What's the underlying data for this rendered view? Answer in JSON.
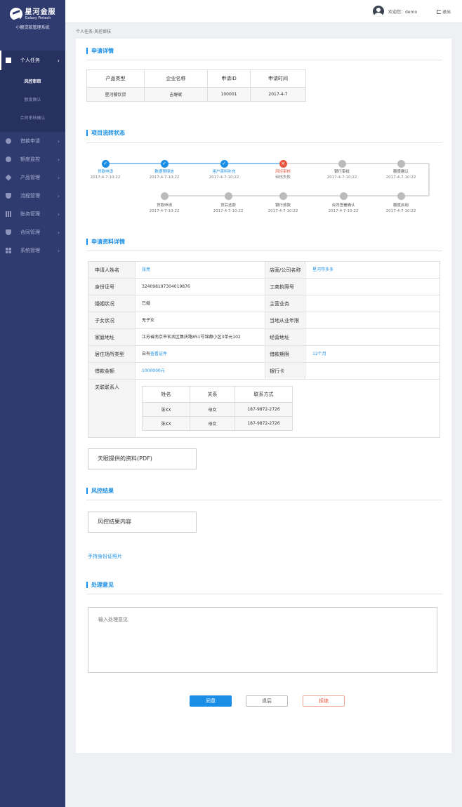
{
  "brand": {
    "name_cn": "星河金服",
    "name_en": "Galaxy Fintech",
    "system": "小额贷款管理系统"
  },
  "sidebar": {
    "items": [
      {
        "label": "个人任务",
        "icon": "task-icon",
        "active": true,
        "children": [
          {
            "label": "风控审审",
            "active": true
          },
          {
            "label": "额度确认",
            "active": false
          },
          {
            "label": "合同审核确认",
            "active": false
          }
        ]
      },
      {
        "label": "借款申请",
        "icon": "loan-icon"
      },
      {
        "label": "额度监控",
        "icon": "pie-icon"
      },
      {
        "label": "产品管理",
        "icon": "product-icon"
      },
      {
        "label": "流程管理",
        "icon": "shield-icon"
      },
      {
        "label": "账务管理",
        "icon": "bar-chart-icon"
      },
      {
        "label": "合同管理",
        "icon": "contract-icon"
      },
      {
        "label": "系统管理",
        "icon": "grid-icon"
      }
    ]
  },
  "topbar": {
    "welcome": "欢迎您：demo",
    "logout": "退出"
  },
  "breadcrumb": "个人任务-风控审核",
  "sections": {
    "application": "申请详情",
    "flow": "项目流转状态",
    "details": "申请资料详情",
    "risk_result": "风控结果",
    "opinion": "处理意见"
  },
  "application": {
    "headers": [
      "产品类型",
      "企业名称",
      "申请ID",
      "申请时间"
    ],
    "row": [
      "星河餐饮贷",
      "吉野家",
      "100001",
      "2017-4-7"
    ]
  },
  "flow": {
    "row1": [
      {
        "label": "贷款申请",
        "date": "2017-4-7-10:22",
        "status": "done"
      },
      {
        "label": "数据预授信",
        "date": "2017-4-7-10:22",
        "status": "done"
      },
      {
        "label": "用户资料补充",
        "date": "2017-4-7-10:22",
        "status": "done"
      },
      {
        "label": "风控审核",
        "date": "审核失败",
        "status": "failed"
      },
      {
        "label": "银行审批",
        "date": "2017-4-7-10:22",
        "status": "pending"
      },
      {
        "label": "额度确认",
        "date": "2017-4-7-10:22",
        "status": "pending"
      }
    ],
    "row2": [
      {
        "label": "额度启用",
        "date": "2017-4-7-10:22",
        "status": "pending"
      },
      {
        "label": "合同签署确认",
        "date": "2017-4-7-10:22",
        "status": "pending"
      },
      {
        "label": "银行放款",
        "date": "2017-4-7-10:22",
        "status": "pending"
      },
      {
        "label": "贷后还款",
        "date": "2017-4-7-10:22",
        "status": "pending"
      },
      {
        "label": "贷款申请",
        "date": "2017-4-7-10:22",
        "status": "pending"
      }
    ]
  },
  "details": {
    "rows": [
      {
        "k1": "申请人姓名",
        "v1": "张亮",
        "v1_link": true,
        "k2": "店面/公司名称",
        "v2": "星河夺多多",
        "v2_link": true
      },
      {
        "k1": "身份证号",
        "v1": "324098197304019876",
        "k2": "工商执照号",
        "v2": ""
      },
      {
        "k1": "婚姻状况",
        "v1": "已婚",
        "k2": "主营业务",
        "v2": ""
      },
      {
        "k1": "子女状况",
        "v1": "无子女",
        "k2": "当地从业年限",
        "v2": ""
      },
      {
        "k1": "家庭地址",
        "v1": "江苏省南京市玄武区集庆路851号锦都小区3单元102",
        "k2": "经营地址",
        "v2": ""
      },
      {
        "k1": "居住场所类型",
        "v1": "自有",
        "v1_extra": "查看证件",
        "k2": "借款期限",
        "v2": "12个月",
        "v2_link": true
      },
      {
        "k1": "借款金额",
        "v1": "1000000元",
        "v1_link": true,
        "k2": "银行卡",
        "v2": ""
      }
    ],
    "contacts_label": "关联联系人",
    "contacts": {
      "headers": [
        "姓名",
        "关系",
        "联系方式"
      ],
      "rows": [
        [
          "张XX",
          "母女",
          "187-9872-2726"
        ],
        [
          "张XX",
          "母女",
          "187-9872-2726"
        ]
      ]
    }
  },
  "tianyan_pdf": "天眼提供的资料(PDF)",
  "risk_result_content": "风控结果内容",
  "id_photo_link": "手持身份证照片",
  "opinion_placeholder": "输入处理意见",
  "actions": {
    "agree": "同意",
    "back": "退后",
    "reject": "拒绝"
  },
  "colors": {
    "sidebar": "#2f3a6e",
    "accent": "#1a8ee6",
    "danger": "#e8563f",
    "pending": "#bbbbbb"
  }
}
